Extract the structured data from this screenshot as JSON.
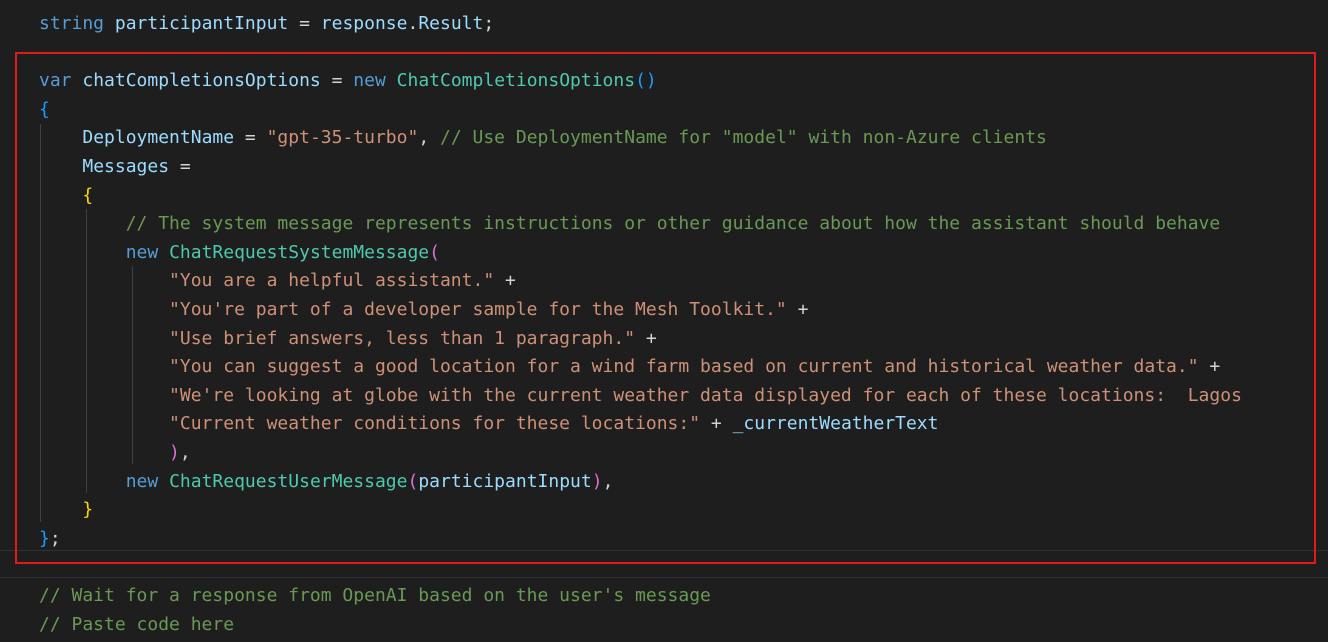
{
  "editor": {
    "lines": [
      [
        {
          "t": "string",
          "c": "kw"
        },
        {
          "t": " ",
          "c": "op"
        },
        {
          "t": "participantInput",
          "c": "va"
        },
        {
          "t": " = ",
          "c": "op"
        },
        {
          "t": "response",
          "c": "va"
        },
        {
          "t": ".",
          "c": "op"
        },
        {
          "t": "Result",
          "c": "va"
        },
        {
          "t": ";",
          "c": "op"
        }
      ],
      [],
      [
        {
          "t": "var",
          "c": "kw"
        },
        {
          "t": " ",
          "c": "op"
        },
        {
          "t": "chatCompletionsOptions",
          "c": "va"
        },
        {
          "t": " = ",
          "c": "op"
        },
        {
          "t": "new",
          "c": "kw"
        },
        {
          "t": " ",
          "c": "op"
        },
        {
          "t": "ChatCompletionsOptions",
          "c": "ty"
        },
        {
          "t": "()",
          "c": "b3"
        }
      ],
      [
        {
          "t": "{",
          "c": "b3"
        }
      ],
      [
        {
          "t": "    ",
          "c": "op"
        },
        {
          "t": "DeploymentName",
          "c": "va"
        },
        {
          "t": " = ",
          "c": "op"
        },
        {
          "t": "\"gpt-35-turbo\"",
          "c": "st"
        },
        {
          "t": ", ",
          "c": "op"
        },
        {
          "t": "// Use DeploymentName for \"model\" with non-Azure clients",
          "c": "cm"
        }
      ],
      [
        {
          "t": "    ",
          "c": "op"
        },
        {
          "t": "Messages",
          "c": "va"
        },
        {
          "t": " =",
          "c": "op"
        }
      ],
      [
        {
          "t": "    ",
          "c": "op"
        },
        {
          "t": "{",
          "c": "b1"
        }
      ],
      [
        {
          "t": "        ",
          "c": "op"
        },
        {
          "t": "// The system message represents instructions or other guidance about how the assistant should behave",
          "c": "cm"
        }
      ],
      [
        {
          "t": "        ",
          "c": "op"
        },
        {
          "t": "new",
          "c": "kw"
        },
        {
          "t": " ",
          "c": "op"
        },
        {
          "t": "ChatRequestSystemMessage",
          "c": "ty"
        },
        {
          "t": "(",
          "c": "b2"
        }
      ],
      [
        {
          "t": "            ",
          "c": "op"
        },
        {
          "t": "\"You are a helpful assistant.\"",
          "c": "st"
        },
        {
          "t": " +",
          "c": "op"
        }
      ],
      [
        {
          "t": "            ",
          "c": "op"
        },
        {
          "t": "\"You're part of a developer sample for the Mesh Toolkit.\"",
          "c": "st"
        },
        {
          "t": " +",
          "c": "op"
        }
      ],
      [
        {
          "t": "            ",
          "c": "op"
        },
        {
          "t": "\"Use brief answers, less than 1 paragraph.\"",
          "c": "st"
        },
        {
          "t": " +",
          "c": "op"
        }
      ],
      [
        {
          "t": "            ",
          "c": "op"
        },
        {
          "t": "\"You can suggest a good location for a wind farm based on current and historical weather data.\"",
          "c": "st"
        },
        {
          "t": " +",
          "c": "op"
        }
      ],
      [
        {
          "t": "            ",
          "c": "op"
        },
        {
          "t": "\"We're looking at globe with the current weather data displayed for each of these locations:  Lagos",
          "c": "st"
        }
      ],
      [
        {
          "t": "            ",
          "c": "op"
        },
        {
          "t": "\"Current weather conditions for these locations:\"",
          "c": "st"
        },
        {
          "t": " + ",
          "c": "op"
        },
        {
          "t": "_currentWeatherText",
          "c": "va"
        }
      ],
      [
        {
          "t": "            ",
          "c": "op"
        },
        {
          "t": ")",
          "c": "b2"
        },
        {
          "t": ",",
          "c": "op"
        }
      ],
      [
        {
          "t": "        ",
          "c": "op"
        },
        {
          "t": "new",
          "c": "kw"
        },
        {
          "t": " ",
          "c": "op"
        },
        {
          "t": "ChatRequestUserMessage",
          "c": "ty"
        },
        {
          "t": "(",
          "c": "b2"
        },
        {
          "t": "participantInput",
          "c": "va"
        },
        {
          "t": ")",
          "c": "b2"
        },
        {
          "t": ",",
          "c": "op"
        }
      ],
      [
        {
          "t": "    ",
          "c": "op"
        },
        {
          "t": "}",
          "c": "b1"
        }
      ],
      [
        {
          "t": "}",
          "c": "b3"
        },
        {
          "t": ";",
          "c": "op"
        }
      ],
      [],
      [
        {
          "t": "// Wait for a response from OpenAI based on the user's message",
          "c": "cm"
        }
      ],
      [
        {
          "t": "// Paste code here",
          "c": "cm"
        }
      ]
    ]
  },
  "colors": {
    "background": "#1e1e1e",
    "highlight_border": "#e01b1b",
    "keyword": "#569cd6",
    "type": "#4ec9b0",
    "variable": "#9cdcfe",
    "string": "#ce9178",
    "comment": "#6a9955"
  }
}
